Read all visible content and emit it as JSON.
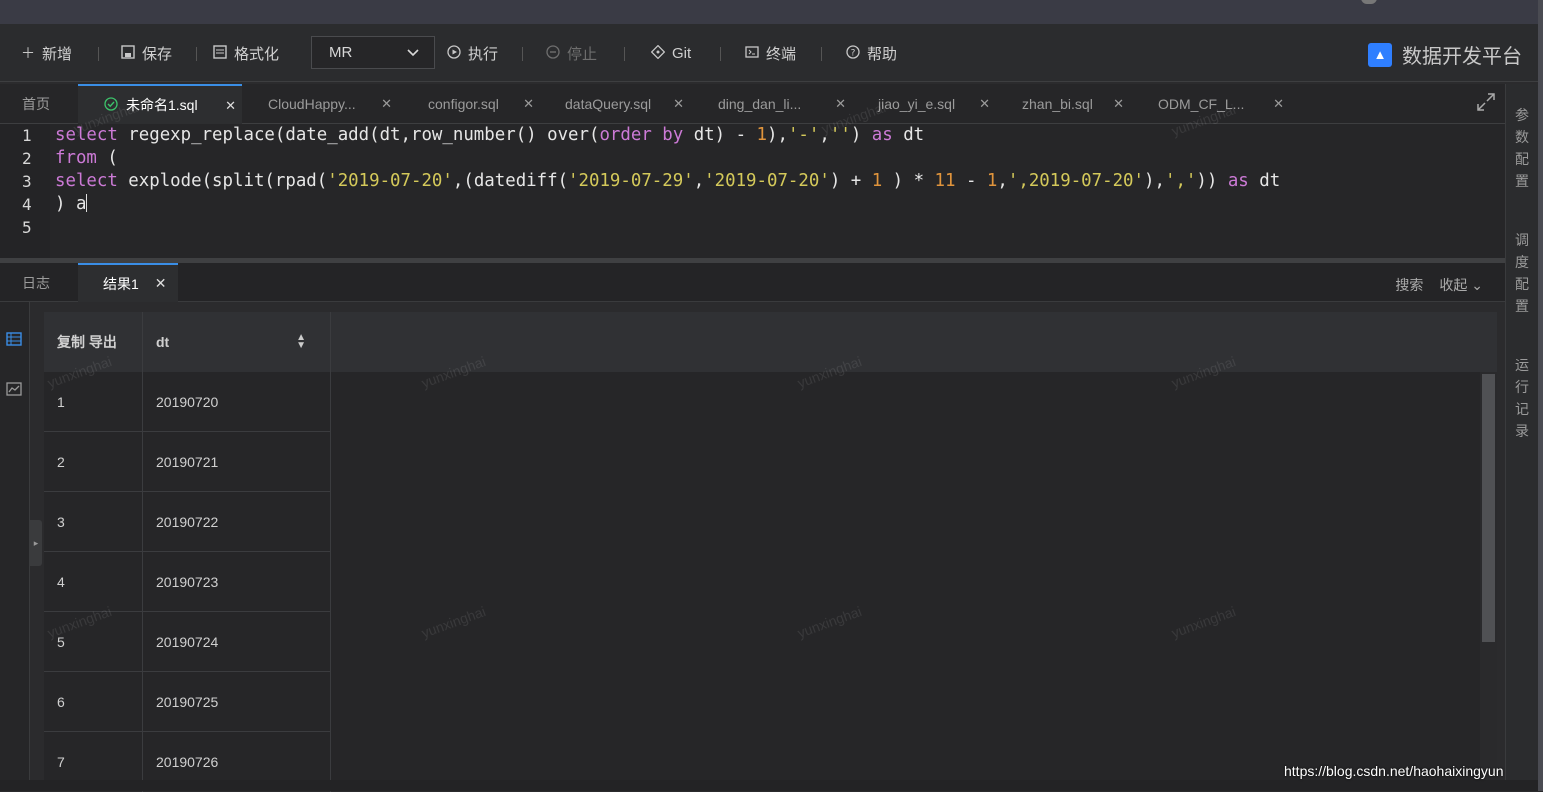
{
  "toolbar": {
    "new_label": "新增",
    "save_label": "保存",
    "format_label": "格式化",
    "engine_select_value": "MR",
    "run_label": "执行",
    "stop_label": "停止",
    "git_label": "Git",
    "terminal_label": "终端",
    "help_label": "帮助",
    "brand_title": "数据开发平台"
  },
  "tabs": [
    {
      "label": "首页"
    },
    {
      "label": "未命名1.sql"
    },
    {
      "label": "CloudHappy..."
    },
    {
      "label": "configor.sql"
    },
    {
      "label": "dataQuery.sql"
    },
    {
      "label": "ding_dan_li..."
    },
    {
      "label": "jiao_yi_e.sql"
    },
    {
      "label": "zhan_bi.sql"
    },
    {
      "label": "ODM_CF_L..."
    }
  ],
  "editor": {
    "line_numbers": [
      "1",
      "2",
      "3",
      "4",
      "5"
    ]
  },
  "result_tabs": {
    "log_label": "日志",
    "result_label": "结果1",
    "search_label": "搜索",
    "collapse_label": "收起"
  },
  "grid": {
    "header_actions": "复制 导出",
    "column_header": "dt",
    "rows": [
      {
        "idx": "1",
        "dt": "20190720"
      },
      {
        "idx": "2",
        "dt": "20190721"
      },
      {
        "idx": "3",
        "dt": "20190722"
      },
      {
        "idx": "4",
        "dt": "20190723"
      },
      {
        "idx": "5",
        "dt": "20190724"
      },
      {
        "idx": "6",
        "dt": "20190725"
      },
      {
        "idx": "7",
        "dt": "20190726"
      }
    ]
  },
  "right_panel": {
    "param_config": "参数配置",
    "schedule_config": "调度配置",
    "run_records": "运行记录"
  },
  "watermark": {
    "user": "yunxinghai",
    "link": "https://blog.csdn.net/haohaixingyun"
  },
  "icons": {
    "new": "plus-icon",
    "save": "save-icon",
    "format": "format-icon",
    "run": "play-icon",
    "stop": "stop-icon",
    "git": "git-icon",
    "terminal": "terminal-icon",
    "help": "help-icon"
  },
  "colors": {
    "accent": "#3a8ee6",
    "success": "#3cc36b",
    "keyword": "#c586c0",
    "string": "#d4c95a",
    "number": "#e0943c"
  }
}
